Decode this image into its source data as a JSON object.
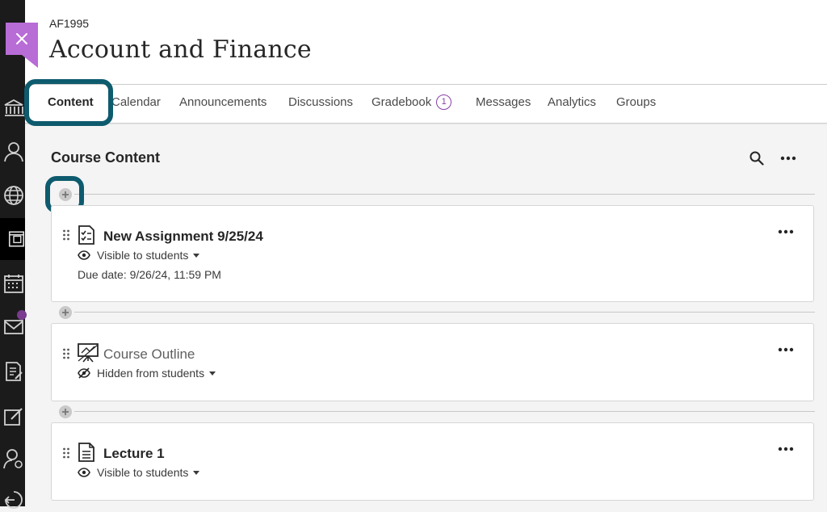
{
  "course": {
    "code": "AF1995",
    "title": "Account and Finance"
  },
  "tabs": [
    {
      "label": "Content"
    },
    {
      "label": "Calendar"
    },
    {
      "label": "Announcements"
    },
    {
      "label": "Discussions"
    },
    {
      "label": "Gradebook",
      "badge": "1"
    },
    {
      "label": "Messages"
    },
    {
      "label": "Analytics"
    },
    {
      "label": "Groups"
    }
  ],
  "content": {
    "title": "Course Content",
    "items": [
      {
        "title": "New Assignment 9/25/24",
        "visibility": "Visible to students",
        "due": "Due date: 9/26/24, 11:59 PM",
        "icon": "assignment-icon"
      },
      {
        "title": "Course Outline",
        "visibility": "Hidden from students",
        "icon": "presentation-icon"
      },
      {
        "title": "Lecture 1",
        "visibility": "Visible to students",
        "icon": "document-icon"
      }
    ]
  },
  "nav_icons": [
    "institution-icon",
    "profile-icon",
    "globe-icon",
    "courses-icon",
    "calendar-icon",
    "messages-icon",
    "grades-icon",
    "tools-icon",
    "admin-icon",
    "signout-icon"
  ],
  "colors": {
    "accent": "#0e5b6e",
    "close_flag": "#b86cd6",
    "badge": "#8a3fa3"
  }
}
